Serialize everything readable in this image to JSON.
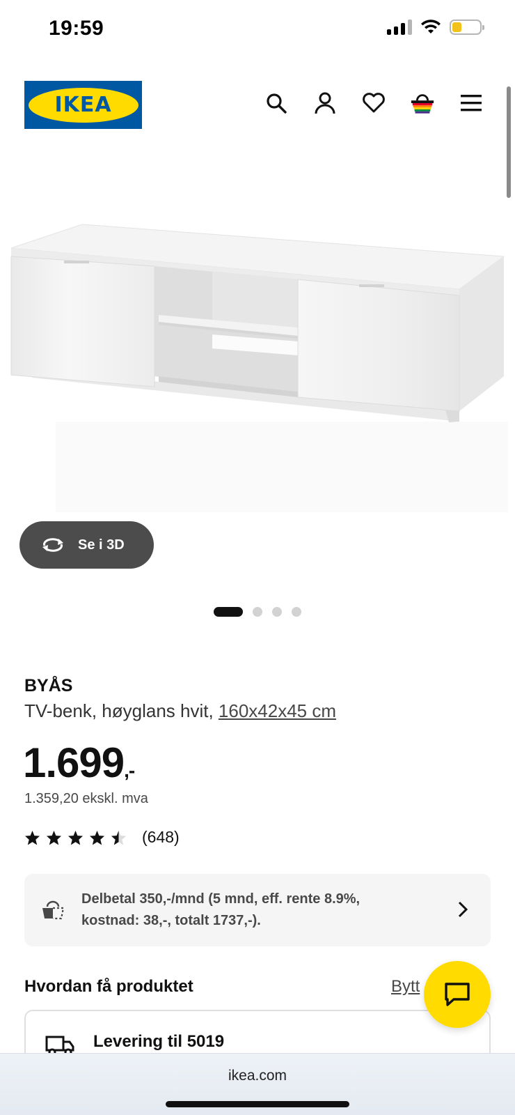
{
  "status_bar": {
    "time": "19:59"
  },
  "header": {
    "logo_text": "IKEA",
    "icons": [
      "search-icon",
      "account-icon",
      "heart-icon",
      "basket-icon",
      "menu-icon"
    ]
  },
  "gallery": {
    "view_3d_label": "Se i 3D",
    "slide_count": 4,
    "active_slide": 1
  },
  "product": {
    "name": "BYÅS",
    "description": "TV-benk, høyglans hvit, ",
    "dimensions": "160x42x45 cm",
    "price": "1.699",
    "price_suffix": ",-",
    "price_ex_vat": "1.359,20 ekskl. mva",
    "rating": 4.5,
    "review_count": "(648)"
  },
  "financing": {
    "text": "Delbetal 350,-/mnd (5 mnd, eff. rente 8.9%, kostnad: 38,-, totalt 1737,-)."
  },
  "delivery": {
    "heading": "Hvordan få produktet",
    "change_label": "Bytt",
    "delivery_title": "Levering til 5019"
  },
  "browser": {
    "url": "ikea.com"
  },
  "colors": {
    "ikea_blue": "#0058a3",
    "ikea_yellow": "#ffdb00",
    "dark_button": "#4c4c4c"
  }
}
